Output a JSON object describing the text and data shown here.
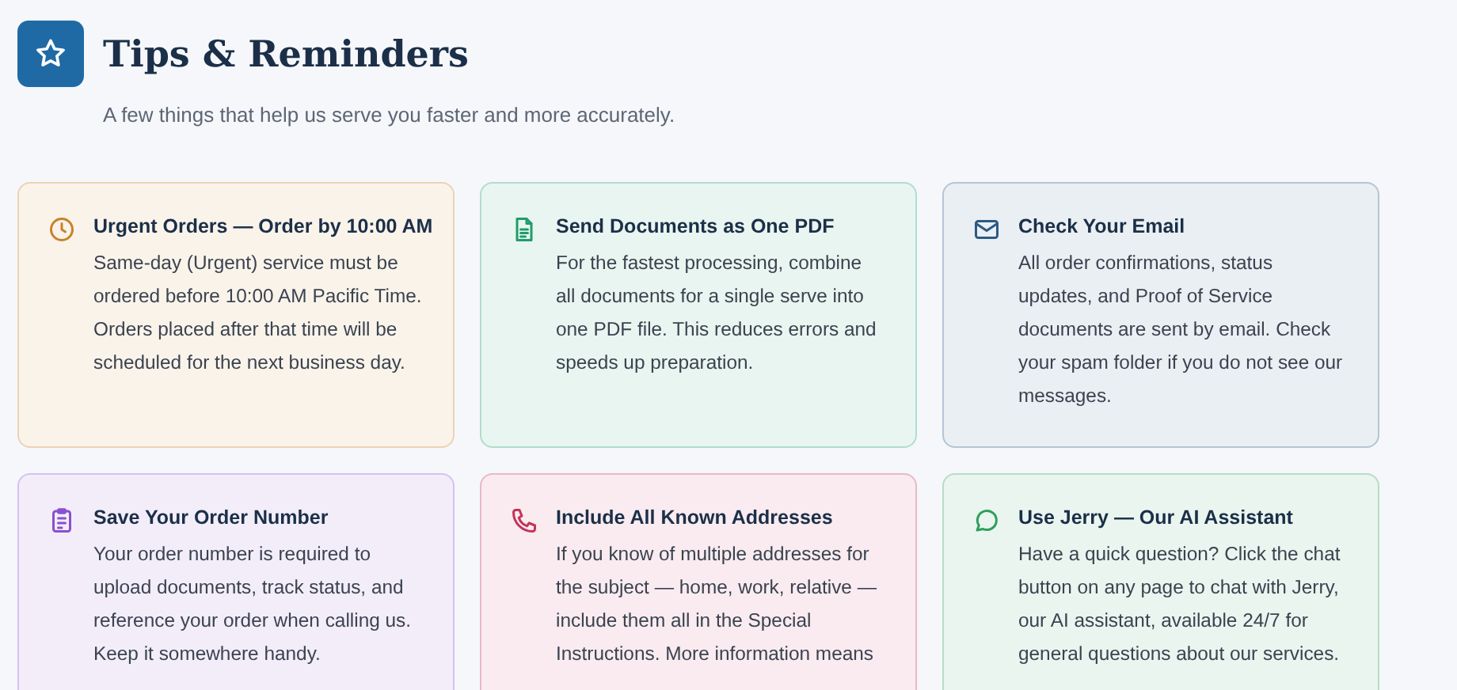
{
  "header": {
    "title": "Tips & Reminders",
    "subtitle": "A few things that help us serve you faster and more accurately."
  },
  "cards": [
    {
      "kind": "clock",
      "color": "#c8822a",
      "title": "Urgent Orders — Order by 10:00 AM",
      "body": "Same-day (Urgent) service must be\nordered before 10:00 AM Pacific Time.\nOrders placed after that time will be\nscheduled for the next business day."
    },
    {
      "kind": "document",
      "color": "#1f9d6b",
      "title": "Send Documents as One PDF",
      "body": "For the fastest processing, combine\nall documents for a single serve into\none PDF file. This reduces errors and\nspeeds up preparation."
    },
    {
      "kind": "mail",
      "color": "#2c5a84",
      "title": "Check Your Email",
      "body": "All order confirmations, status\nupdates, and Proof of Service\ndocuments are sent by email. Check\nyour spam folder if you do not see our\nmessages."
    },
    {
      "kind": "clipboard",
      "color": "#8a4fd0",
      "title": "Save Your Order Number",
      "body": "Your order number is required to\nupload documents, track status, and\nreference your order when calling us.\nKeep it somewhere handy."
    },
    {
      "kind": "phone",
      "color": "#c2335a",
      "title": "Include All Known Addresses",
      "body": "If you know of multiple addresses for\nthe subject — home, work, relative —\ninclude them all in the Special\nInstructions. More information means"
    },
    {
      "kind": "chat",
      "color": "#2f9e5a",
      "title": "Use Jerry — Our AI Assistant",
      "body": "Have a quick question? Click the chat\nbutton on any page to chat with Jerry,\nour AI assistant, available 24/7 for\ngeneral questions about our services."
    }
  ]
}
